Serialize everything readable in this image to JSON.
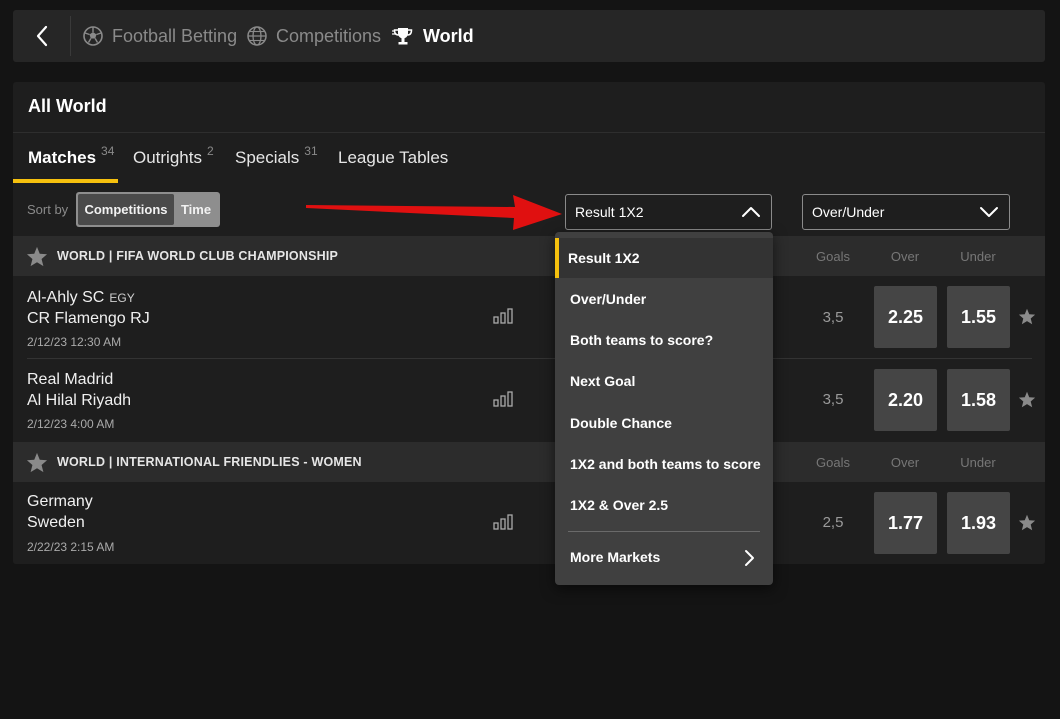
{
  "nav": {
    "breadcrumbs": [
      {
        "label": "Football Betting",
        "icon": "football-icon"
      },
      {
        "label": "Competitions",
        "icon": "globe-icon"
      },
      {
        "label": "World",
        "icon": "trophy-icon"
      }
    ]
  },
  "panel": {
    "title": "All World",
    "tabs": [
      {
        "label": "Matches",
        "count": "34"
      },
      {
        "label": "Outrights",
        "count": "2"
      },
      {
        "label": "Specials",
        "count": "31"
      },
      {
        "label": "League Tables",
        "count": ""
      }
    ]
  },
  "sort": {
    "label": "Sort by",
    "options": [
      "Competitions",
      "Time"
    ],
    "selected": "Competitions"
  },
  "selects": {
    "market1": "Result 1X2",
    "market2": "Over/Under"
  },
  "columns": {
    "goals": "Goals",
    "over": "Over",
    "under": "Under"
  },
  "groups": [
    {
      "title": "WORLD | FIFA WORLD CLUB CHAMPIONSHIP",
      "matches": [
        {
          "home": "Al-Ahly SC",
          "home_country": "EGY",
          "away": "CR Flamengo RJ",
          "time": "2/12/23 12:30 AM",
          "goals": "3,5",
          "over": "2.25",
          "under": "1.55"
        },
        {
          "home": "Real Madrid",
          "home_country": "",
          "away": "Al Hilal Riyadh",
          "time": "2/12/23 4:00 AM",
          "goals": "3,5",
          "over": "2.20",
          "under": "1.58"
        }
      ]
    },
    {
      "title": "WORLD | INTERNATIONAL FRIENDLIES - WOMEN",
      "matches": [
        {
          "home": "Germany",
          "home_country": "",
          "away": "Sweden",
          "time": "2/22/23 2:15 AM",
          "goals": "2,5",
          "over": "1.77",
          "under": "1.93"
        }
      ]
    }
  ],
  "dropdown": {
    "items": [
      "Result 1X2",
      "Over/Under",
      "Both teams to score?",
      "Next Goal",
      "Double Chance",
      "1X2 and both teams to score",
      "1X2 & Over 2.5"
    ],
    "selected": "Result 1X2",
    "more": "More Markets"
  },
  "colors": {
    "accent": "#f6c10e",
    "annotation_arrow": "#e01010"
  }
}
